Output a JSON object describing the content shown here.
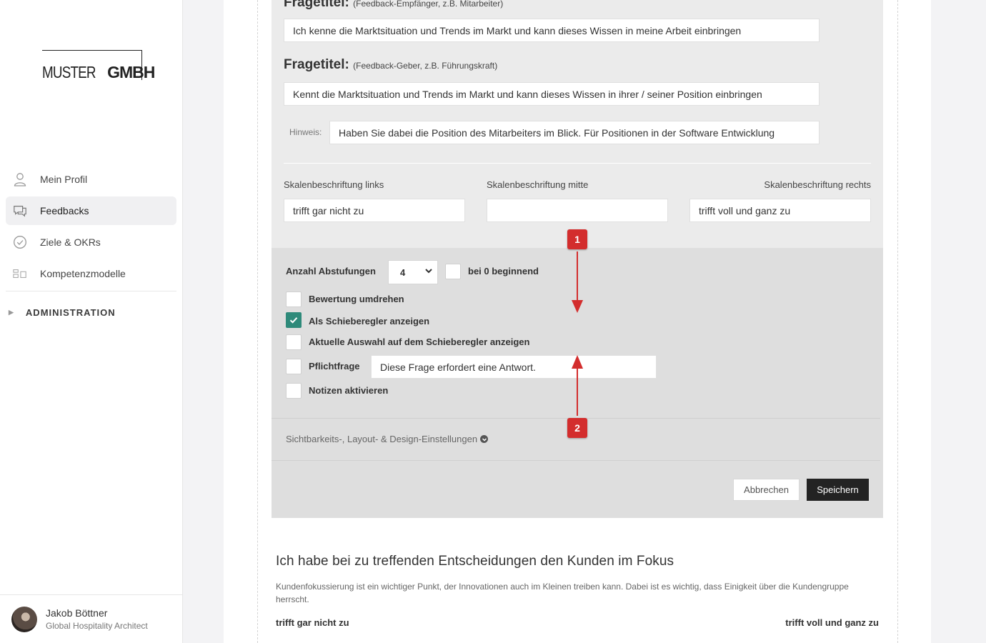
{
  "brand": {
    "logo_thin": "MUSTER",
    "logo_bold": "GMBH"
  },
  "sidebar": {
    "items": [
      {
        "label": "Mein Profil",
        "icon": "user-icon",
        "active": false
      },
      {
        "label": "Feedbacks",
        "icon": "chat-icon",
        "active": true
      },
      {
        "label": "Ziele & OKRs",
        "icon": "check-circle-icon",
        "active": false
      },
      {
        "label": "Kompetenzmodelle",
        "icon": "grid-icon",
        "active": false
      }
    ],
    "admin_label": "ADMINISTRATION"
  },
  "user": {
    "name": "Jakob Böttner",
    "role": "Global Hospitality Architect"
  },
  "editor": {
    "q1_label": "Fragetitel:",
    "q1_sub": "(Feedback-Empfänger, z.B. Mitarbeiter)",
    "q1_value": "Ich kenne die Marktsituation und Trends im Markt und kann dieses Wissen in meine Arbeit einbringen",
    "q2_label": "Fragetitel:",
    "q2_sub": "(Feedback-Geber, z.B. Führungskraft)",
    "q2_value": "Kennt die Marktsituation und Trends im Markt und kann dieses Wissen in ihrer / seiner Position einbringen",
    "hint_label": "Hinweis:",
    "hint_value": "Haben Sie dabei die Position des Mitarbeiters im Blick. Für Positionen in der Software Entwicklung",
    "scale_left_label": "Skalenbeschriftung links",
    "scale_mid_label": "Skalenbeschriftung mitte",
    "scale_right_label": "Skalenbeschriftung rechts",
    "scale_left_value": "trifft gar nicht zu",
    "scale_mid_value": "",
    "scale_right_value": "trifft voll und ganz zu",
    "steps_label": "Anzahl Abstufungen",
    "steps_value": "4",
    "zero_label": "bei 0 beginnend",
    "opt_reverse": "Bewertung umdrehen",
    "opt_slider": "Als Schieberegler anzeigen",
    "opt_current": "Aktuelle Auswahl auf dem Schieberegler anzeigen",
    "opt_required": "Pflichtfrage",
    "required_msg": "Diese Frage erfordert eine Antwort.",
    "opt_notes": "Notizen aktivieren",
    "design_link": "Sichtbarkeits-, Layout- & Design-Einstellungen",
    "cancel": "Abbrechen",
    "save": "Speichern"
  },
  "annotations": {
    "badge1": "1",
    "badge2": "2",
    "color": "#d32d2d"
  },
  "next_question": {
    "title": "Ich habe bei zu treffenden Entscheidungen den Kunden im Fokus",
    "desc": "Kundenfokussierung ist ein wichtiger Punkt, der Innovationen auch im Kleinen treiben kann. Dabei ist es wichtig, dass Einigkeit über die Kundengruppe herrscht.",
    "scale_left": "trifft gar nicht zu",
    "scale_right": "trifft voll und ganz zu"
  }
}
